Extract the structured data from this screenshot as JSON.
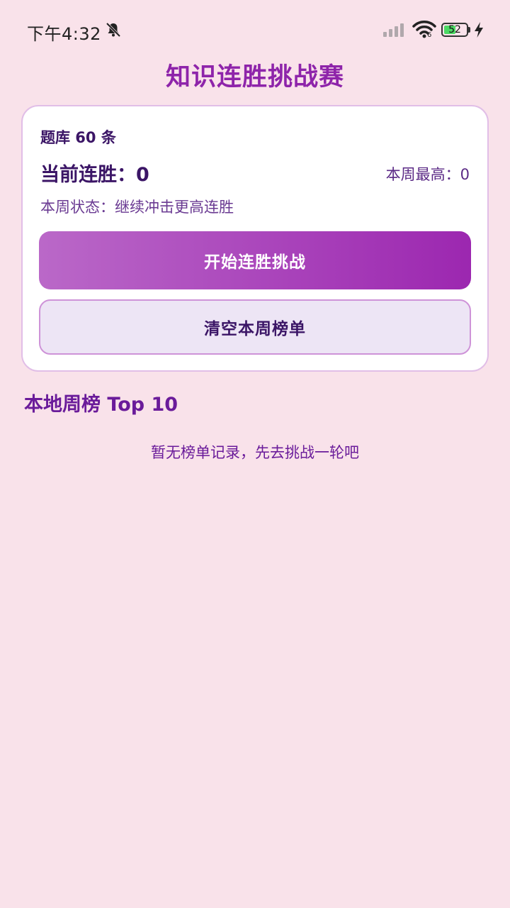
{
  "status_bar": {
    "time": "下午4:32",
    "wifi_sub": "6",
    "battery_level": "52",
    "battery_fraction": 0.52,
    "icons": [
      "bell-off-icon",
      "signal-icon",
      "wifi-icon",
      "battery-icon",
      "charging-icon"
    ]
  },
  "header": {
    "title": "知识连胜挑战赛"
  },
  "card": {
    "bank_count": "题库 60 条",
    "current_streak": "当前连胜：0",
    "weekly_best": "本周最高：0",
    "week_status": "本周状态：继续冲击更高连胜",
    "start_button": "开始连胜挑战",
    "clear_button": "清空本周榜单"
  },
  "leaderboard": {
    "title": "本地周榜 Top 10",
    "empty_text": "暂无榜单记录，先去挑战一轮吧"
  },
  "colors": {
    "background": "#f9e2ea",
    "title": "#8e24aa",
    "accent_gradient_start": "#ba68c8",
    "accent_gradient_end": "#9c27b0",
    "secondary_button_bg": "#ede5f5",
    "secondary_button_border": "#ce93d8",
    "battery_fill": "#4cd964"
  }
}
